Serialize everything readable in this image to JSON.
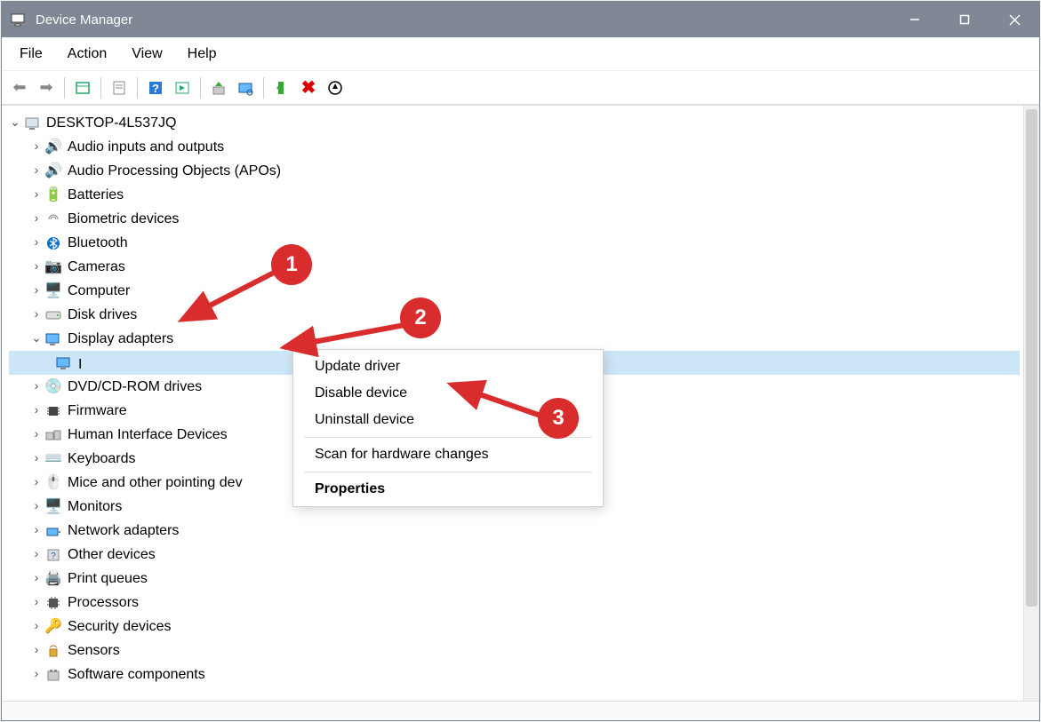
{
  "window": {
    "title": "Device Manager"
  },
  "menu": {
    "file": "File",
    "action": "Action",
    "view": "View",
    "help": "Help"
  },
  "tree": {
    "root": "DESKTOP-4L537JQ",
    "items": [
      "Audio inputs and outputs",
      "Audio Processing Objects (APOs)",
      "Batteries",
      "Biometric devices",
      "Bluetooth",
      "Cameras",
      "Computer",
      "Disk drives",
      "Display adapters",
      "DVD/CD-ROM drives",
      "Firmware",
      "Human Interface Devices",
      "Keyboards",
      "Mice and other pointing dev",
      "Monitors",
      "Network adapters",
      "Other devices",
      "Print queues",
      "Processors",
      "Security devices",
      "Sensors",
      "Software components"
    ],
    "display_child": "I"
  },
  "context": {
    "update": "Update driver",
    "disable": "Disable device",
    "uninstall": "Uninstall device",
    "scan": "Scan for hardware changes",
    "properties": "Properties"
  },
  "badges": {
    "one": "1",
    "two": "2",
    "three": "3"
  }
}
